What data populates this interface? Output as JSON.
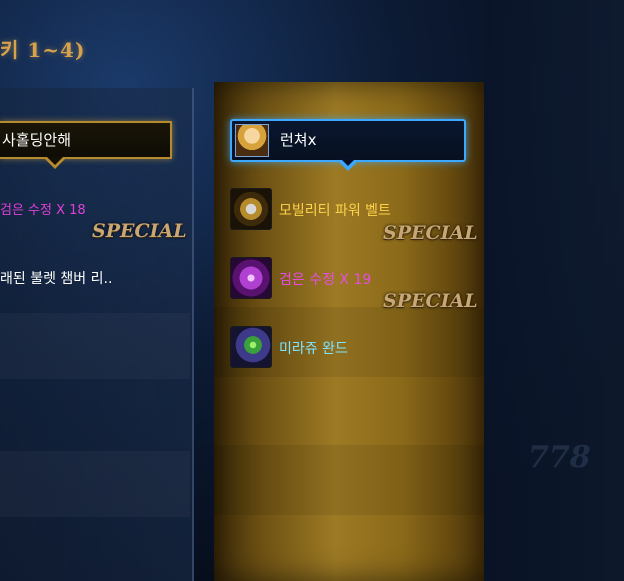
{
  "header": {
    "title": "키 1~4)"
  },
  "left_panel": {
    "player_name": "사홀딩안해",
    "item_1": {
      "name": "검은 수정 X 18",
      "badge": "SPECIAL",
      "color": "#e040d8"
    },
    "item_2": {
      "name": "래된 불렛 챔버 리.."
    }
  },
  "right_panel": {
    "player_name": "런쳐x",
    "items": [
      {
        "name": "모빌리티 파워 벨트",
        "badge": "SPECIAL",
        "icon": "belt-icon",
        "color": "#ffd34a"
      },
      {
        "name": "검은 수정 X 19",
        "badge": "SPECIAL",
        "icon": "crystal-icon",
        "color": "#e54ee0"
      },
      {
        "name": "미라쥬 완드",
        "badge": "",
        "icon": "wand-icon",
        "color": "#7fe6ff"
      }
    ]
  },
  "theme": {
    "accent_blue": "#3da8ff",
    "accent_gold": "#b58b2c"
  }
}
